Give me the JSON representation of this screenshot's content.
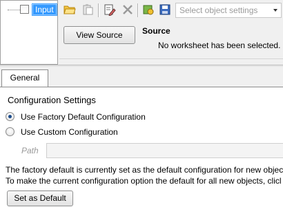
{
  "tree": {
    "node_label": "Input"
  },
  "toolbar": {
    "icons": [
      "open-folder-icon",
      "paste-icon",
      "edit-icon",
      "delete-icon",
      "refresh-icon",
      "save-icon"
    ],
    "object_settings_placeholder": "Select object settings"
  },
  "source": {
    "view_button": "View Source",
    "title": "Source",
    "message": "No worksheet has been selected."
  },
  "tabs": {
    "general": "General"
  },
  "config": {
    "title": "Configuration Settings",
    "options": [
      "Use Factory Default Configuration",
      "Use Custom Configuration"
    ],
    "selected_index": 0,
    "path_label": "Path",
    "path_value": "",
    "info_line1": "The factory default is currently set as the default configuration for new objec",
    "info_line2": "To make the current configuration option the default for all new objects, clicl",
    "set_default_button": "Set as Default"
  },
  "colors": {
    "selection": "#3399ff",
    "radio_dot": "#1a4a8a"
  }
}
